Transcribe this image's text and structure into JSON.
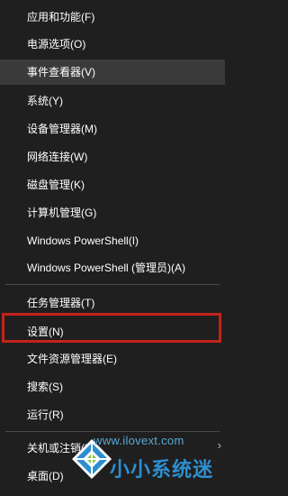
{
  "menu": {
    "items": [
      {
        "label": "应用和功能(F)"
      },
      {
        "label": "电源选项(O)"
      },
      {
        "label": "事件查看器(V)"
      },
      {
        "label": "系统(Y)"
      },
      {
        "label": "设备管理器(M)"
      },
      {
        "label": "网络连接(W)"
      },
      {
        "label": "磁盘管理(K)"
      },
      {
        "label": "计算机管理(G)"
      },
      {
        "label": "Windows PowerShell(I)"
      },
      {
        "label": "Windows PowerShell (管理员)(A)"
      },
      {
        "label": "任务管理器(T)"
      },
      {
        "label": "设置(N)"
      },
      {
        "label": "文件资源管理器(E)"
      },
      {
        "label": "搜索(S)"
      },
      {
        "label": "运行(R)"
      },
      {
        "label": "关机或注销(U)"
      },
      {
        "label": "桌面(D)"
      }
    ],
    "submenu_arrow": "›"
  },
  "watermark": {
    "url": "www.ilovext.com",
    "brand": "小小系统迷"
  },
  "colors": {
    "background": "#1f1f1f",
    "hover": "#3a3a3a",
    "highlight_border": "#c4231b",
    "watermark_blue": "#2d8fd0"
  },
  "icons": {
    "submenu": "chevron-right-icon",
    "watermark_logo": "diamond-logo-icon"
  }
}
